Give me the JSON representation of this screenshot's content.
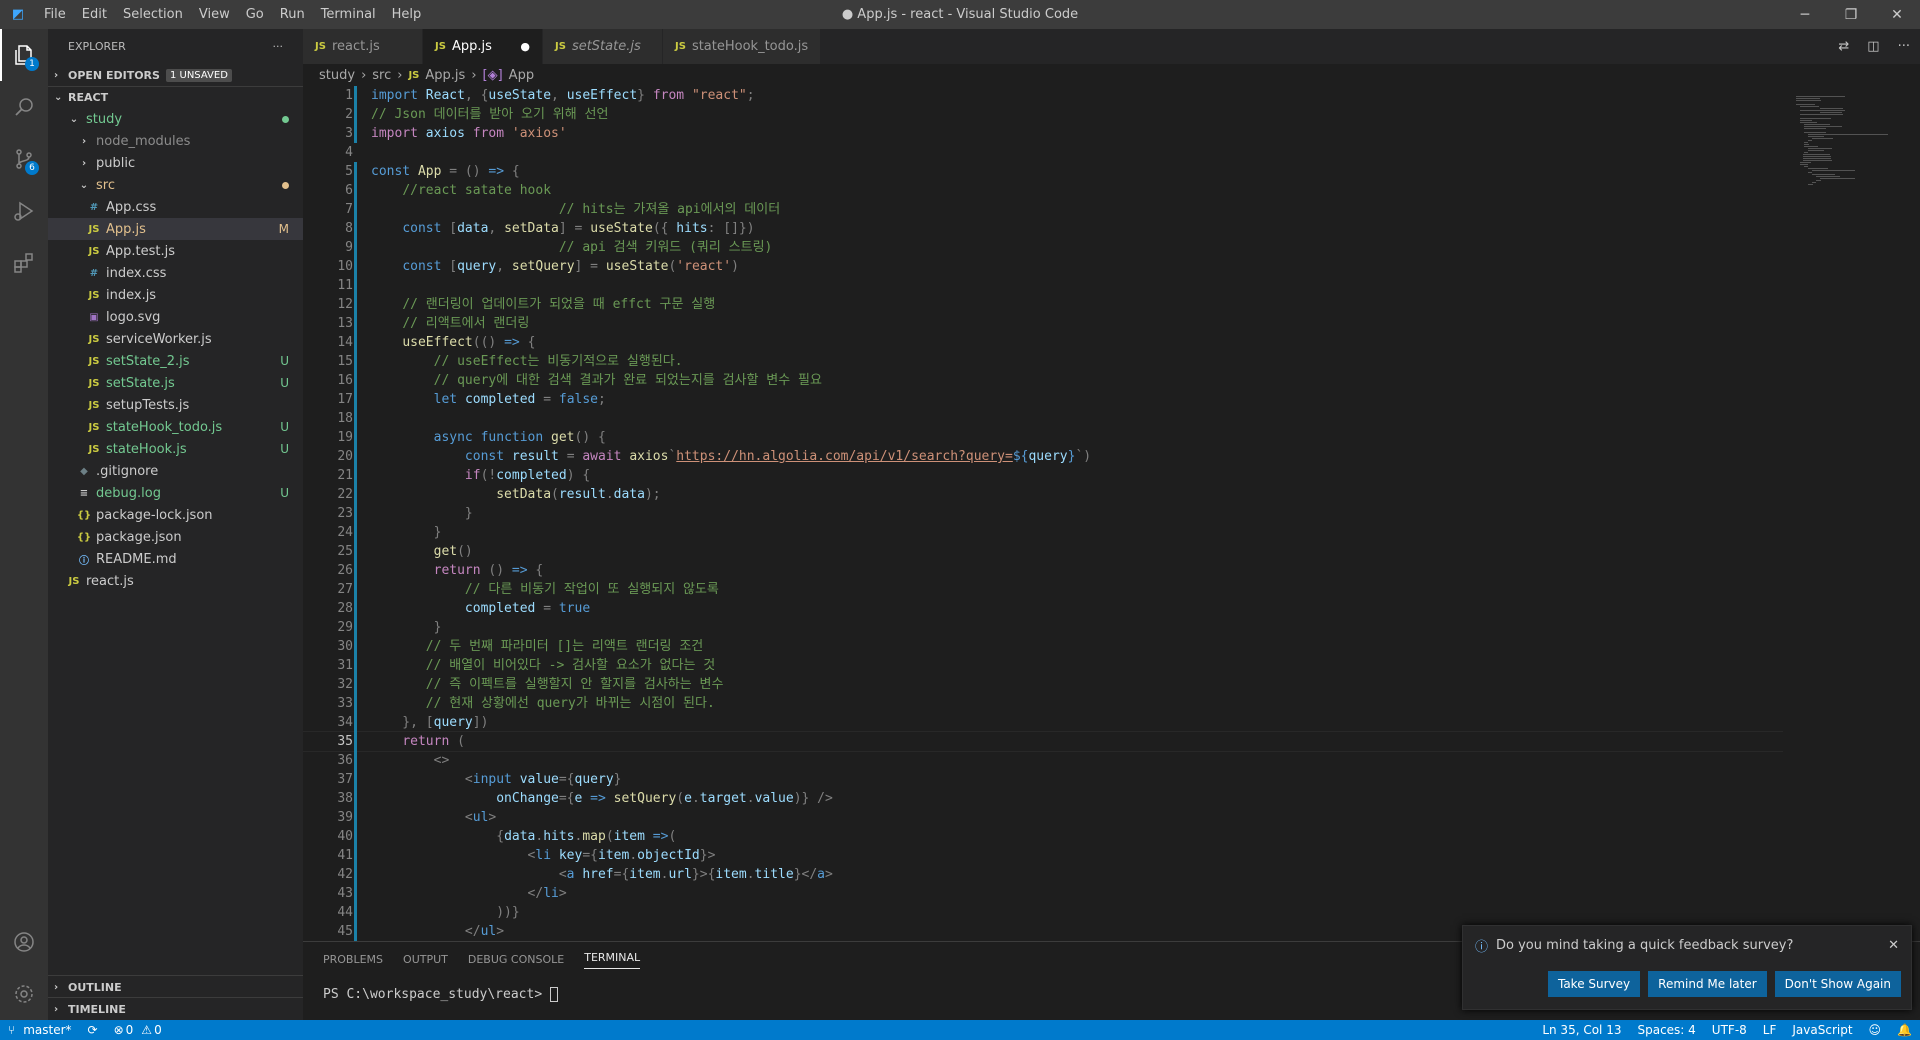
{
  "titlebar": {
    "menu": [
      "File",
      "Edit",
      "Selection",
      "View",
      "Go",
      "Run",
      "Terminal",
      "Help"
    ],
    "title": "● App.js - react - Visual Studio Code"
  },
  "activity": {
    "explorer_badge": "1",
    "scm_badge": "6"
  },
  "sidebar": {
    "header": "EXPLORER",
    "open_editors": "OPEN EDITORS",
    "unsaved": "1 UNSAVED",
    "root": "REACT",
    "items": [
      {
        "label": "study",
        "kind": "folder-open",
        "indent": 1,
        "status": "dot",
        "color": "green"
      },
      {
        "label": "node_modules",
        "kind": "folder",
        "indent": 2,
        "status": "",
        "color": "gray"
      },
      {
        "label": "public",
        "kind": "folder",
        "indent": 2,
        "status": "",
        "color": "normal"
      },
      {
        "label": "src",
        "kind": "folder-open",
        "indent": 2,
        "status": "dot",
        "color": "mod"
      },
      {
        "label": "App.css",
        "kind": "css",
        "indent": 3,
        "status": "",
        "color": "normal"
      },
      {
        "label": "App.js",
        "kind": "js",
        "indent": 3,
        "status": "M",
        "color": "mod",
        "selected": true
      },
      {
        "label": "App.test.js",
        "kind": "js",
        "indent": 3,
        "status": "",
        "color": "normal"
      },
      {
        "label": "index.css",
        "kind": "css",
        "indent": 3,
        "status": "",
        "color": "normal"
      },
      {
        "label": "index.js",
        "kind": "js",
        "indent": 3,
        "status": "",
        "color": "normal"
      },
      {
        "label": "logo.svg",
        "kind": "svg",
        "indent": 3,
        "status": "",
        "color": "normal"
      },
      {
        "label": "serviceWorker.js",
        "kind": "js",
        "indent": 3,
        "status": "",
        "color": "normal"
      },
      {
        "label": "setState_2.js",
        "kind": "js",
        "indent": 3,
        "status": "U",
        "color": "green"
      },
      {
        "label": "setState.js",
        "kind": "js",
        "indent": 3,
        "status": "U",
        "color": "green"
      },
      {
        "label": "setupTests.js",
        "kind": "js",
        "indent": 3,
        "status": "",
        "color": "normal"
      },
      {
        "label": "stateHook_todo.js",
        "kind": "js",
        "indent": 3,
        "status": "U",
        "color": "green"
      },
      {
        "label": "stateHook.js",
        "kind": "js",
        "indent": 3,
        "status": "U",
        "color": "green"
      },
      {
        "label": ".gitignore",
        "kind": "git",
        "indent": 2,
        "status": "",
        "color": "normal"
      },
      {
        "label": "debug.log",
        "kind": "log",
        "indent": 2,
        "status": "U",
        "color": "green"
      },
      {
        "label": "package-lock.json",
        "kind": "json",
        "indent": 2,
        "status": "",
        "color": "normal"
      },
      {
        "label": "package.json",
        "kind": "json",
        "indent": 2,
        "status": "",
        "color": "normal"
      },
      {
        "label": "README.md",
        "kind": "info",
        "indent": 2,
        "status": "",
        "color": "normal"
      },
      {
        "label": "react.js",
        "kind": "js",
        "indent": 1,
        "status": "",
        "color": "normal"
      }
    ],
    "outline": "OUTLINE",
    "timeline": "TIMELINE"
  },
  "tabs": [
    {
      "label": "react.js",
      "active": false,
      "italic": false
    },
    {
      "label": "App.js",
      "active": true,
      "italic": false,
      "dirty": "●"
    },
    {
      "label": "setState.js",
      "active": false,
      "italic": true
    },
    {
      "label": "stateHook_todo.js",
      "active": false,
      "italic": false
    }
  ],
  "breadcrumb": [
    "study",
    "src",
    "App.js",
    "App"
  ],
  "code": [
    [
      [
        "k",
        "import "
      ],
      [
        "v",
        "React"
      ],
      [
        "t",
        ", {"
      ],
      [
        "v",
        "useState"
      ],
      [
        "t",
        ", "
      ],
      [
        "v",
        "useEffect"
      ],
      [
        "t",
        "} "
      ],
      [
        "p",
        "from "
      ],
      [
        "s",
        "\"react\""
      ],
      [
        "t",
        ";"
      ]
    ],
    [
      [
        "c",
        "// Json 데이터를 받아 오기 위해 선언"
      ]
    ],
    [
      [
        "p",
        "import "
      ],
      [
        "v",
        "axios "
      ],
      [
        "p",
        "from "
      ],
      [
        "s",
        "'axios'"
      ]
    ],
    [],
    [
      [
        "k",
        "const "
      ],
      [
        "f",
        "App "
      ],
      [
        "t",
        "= () "
      ],
      [
        "k",
        "=> "
      ],
      [
        "t",
        "{"
      ]
    ],
    [
      [
        "t",
        "    "
      ],
      [
        "c",
        "//react satate hook"
      ]
    ],
    [
      [
        "t",
        "                        "
      ],
      [
        "c",
        "// hits는 가져올 api에서의 데이터"
      ]
    ],
    [
      [
        "t",
        "    "
      ],
      [
        "k",
        "const "
      ],
      [
        "t",
        "["
      ],
      [
        "v",
        "data"
      ],
      [
        "t",
        ", "
      ],
      [
        "f",
        "setData"
      ],
      [
        "t",
        "] = "
      ],
      [
        "f",
        "useState"
      ],
      [
        "t",
        "({ "
      ],
      [
        "v",
        "hits"
      ],
      [
        "t",
        ": []})"
      ]
    ],
    [
      [
        "t",
        "                        "
      ],
      [
        "c",
        "// api 검색 키워드 (쿼리 스트링)"
      ]
    ],
    [
      [
        "t",
        "    "
      ],
      [
        "k",
        "const "
      ],
      [
        "t",
        "["
      ],
      [
        "v",
        "query"
      ],
      [
        "t",
        ", "
      ],
      [
        "f",
        "setQuery"
      ],
      [
        "t",
        "] = "
      ],
      [
        "f",
        "useState"
      ],
      [
        "t",
        "("
      ],
      [
        "s",
        "'react'"
      ],
      [
        "t",
        ")"
      ]
    ],
    [],
    [
      [
        "t",
        "    "
      ],
      [
        "c",
        "// 랜더링이 업데이트가 되었을 때 effct 구문 실행"
      ]
    ],
    [
      [
        "t",
        "    "
      ],
      [
        "c",
        "// 리액트에서 랜더링"
      ]
    ],
    [
      [
        "t",
        "    "
      ],
      [
        "f",
        "useEffect"
      ],
      [
        "t",
        "(() "
      ],
      [
        "k",
        "=> "
      ],
      [
        "t",
        "{"
      ]
    ],
    [
      [
        "t",
        "        "
      ],
      [
        "c",
        "// useEffect는 비동기적으로 실행된다."
      ]
    ],
    [
      [
        "t",
        "        "
      ],
      [
        "c",
        "// query에 대한 검색 결과가 완료 되었는지를 검사할 변수 필요"
      ]
    ],
    [
      [
        "t",
        "        "
      ],
      [
        "k",
        "let "
      ],
      [
        "v",
        "completed "
      ],
      [
        "t",
        "= "
      ],
      [
        "k",
        "false"
      ],
      [
        "t",
        ";"
      ]
    ],
    [],
    [
      [
        "t",
        "        "
      ],
      [
        "k",
        "async function "
      ],
      [
        "f",
        "get"
      ],
      [
        "t",
        "() {"
      ]
    ],
    [
      [
        "t",
        "            "
      ],
      [
        "k",
        "const "
      ],
      [
        "v",
        "result "
      ],
      [
        "t",
        "= "
      ],
      [
        "p",
        "await "
      ],
      [
        "f",
        "axios"
      ],
      [
        "t",
        "`"
      ],
      [
        "u",
        "https://hn.algolia.com/api/v1/search?query="
      ],
      [
        "k",
        "${"
      ],
      [
        "v",
        "query"
      ],
      [
        "k",
        "}"
      ],
      [
        "t",
        "`)"
      ]
    ],
    [
      [
        "t",
        "            "
      ],
      [
        "p",
        "if"
      ],
      [
        "t",
        "(!"
      ],
      [
        "v",
        "completed"
      ],
      [
        "t",
        ") {"
      ]
    ],
    [
      [
        "t",
        "                "
      ],
      [
        "f",
        "setData"
      ],
      [
        "t",
        "("
      ],
      [
        "v",
        "result"
      ],
      [
        "t",
        "."
      ],
      [
        "v",
        "data"
      ],
      [
        "t",
        ");"
      ]
    ],
    [
      [
        "t",
        "            }"
      ]
    ],
    [
      [
        "t",
        "        }"
      ]
    ],
    [
      [
        "t",
        "        "
      ],
      [
        "f",
        "get"
      ],
      [
        "t",
        "()"
      ]
    ],
    [
      [
        "t",
        "        "
      ],
      [
        "p",
        "return "
      ],
      [
        "t",
        "() "
      ],
      [
        "k",
        "=> "
      ],
      [
        "t",
        "{"
      ]
    ],
    [
      [
        "t",
        "            "
      ],
      [
        "c",
        "// 다른 비동기 작업이 또 실행되지 않도록"
      ]
    ],
    [
      [
        "t",
        "            "
      ],
      [
        "v",
        "completed "
      ],
      [
        "t",
        "= "
      ],
      [
        "k",
        "true"
      ]
    ],
    [
      [
        "t",
        "        }"
      ]
    ],
    [
      [
        "t",
        "       "
      ],
      [
        "c",
        "// 두 번째 파라미터 []는 리액트 랜더링 조건"
      ]
    ],
    [
      [
        "t",
        "       "
      ],
      [
        "c",
        "// 배열이 비어있다 -> 검사할 요소가 없다는 것"
      ]
    ],
    [
      [
        "t",
        "       "
      ],
      [
        "c",
        "// 즉 이펙트를 실행할지 안 할지를 검사하는 변수"
      ]
    ],
    [
      [
        "t",
        "       "
      ],
      [
        "c",
        "// 현재 상황에선 query가 바뀌는 시점이 된다."
      ]
    ],
    [
      [
        "t",
        "    }, ["
      ],
      [
        "v",
        "query"
      ],
      [
        "t",
        "])"
      ]
    ],
    [
      [
        "t",
        "    "
      ],
      [
        "p",
        "return "
      ],
      [
        "t",
        "("
      ]
    ],
    [
      [
        "t",
        "        "
      ],
      [
        "t",
        "<>"
      ]
    ],
    [
      [
        "t",
        "            "
      ],
      [
        "t",
        "<"
      ],
      [
        "tg",
        "input "
      ],
      [
        "v",
        "value"
      ],
      [
        "t",
        "={"
      ],
      [
        "v",
        "query"
      ],
      [
        "t",
        "}"
      ]
    ],
    [
      [
        "t",
        "                "
      ],
      [
        "v",
        "onChange"
      ],
      [
        "t",
        "={"
      ],
      [
        "v",
        "e "
      ],
      [
        "k",
        "=> "
      ],
      [
        "f",
        "setQuery"
      ],
      [
        "t",
        "("
      ],
      [
        "v",
        "e"
      ],
      [
        "t",
        "."
      ],
      [
        "v",
        "target"
      ],
      [
        "t",
        "."
      ],
      [
        "v",
        "value"
      ],
      [
        "t",
        ")} />"
      ]
    ],
    [
      [
        "t",
        "            "
      ],
      [
        "t",
        "<"
      ],
      [
        "tg",
        "ul"
      ],
      [
        "t",
        ">"
      ]
    ],
    [
      [
        "t",
        "                {"
      ],
      [
        "v",
        "data"
      ],
      [
        "t",
        "."
      ],
      [
        "v",
        "hits"
      ],
      [
        "t",
        "."
      ],
      [
        "f",
        "map"
      ],
      [
        "t",
        "("
      ],
      [
        "v",
        "item "
      ],
      [
        "k",
        "=>"
      ],
      [
        "t",
        "("
      ]
    ],
    [
      [
        "t",
        "                    "
      ],
      [
        "t",
        "<"
      ],
      [
        "tg",
        "li "
      ],
      [
        "v",
        "key"
      ],
      [
        "t",
        "={"
      ],
      [
        "v",
        "item"
      ],
      [
        "t",
        "."
      ],
      [
        "v",
        "objectId"
      ],
      [
        "t",
        "}>"
      ]
    ],
    [
      [
        "t",
        "                        "
      ],
      [
        "t",
        "<"
      ],
      [
        "tg",
        "a "
      ],
      [
        "v",
        "href"
      ],
      [
        "t",
        "={"
      ],
      [
        "v",
        "item"
      ],
      [
        "t",
        "."
      ],
      [
        "v",
        "url"
      ],
      [
        "t",
        "}>{"
      ],
      [
        "v",
        "item"
      ],
      [
        "t",
        "."
      ],
      [
        "v",
        "title"
      ],
      [
        "t",
        "}</"
      ],
      [
        "tg",
        "a"
      ],
      [
        "t",
        ">"
      ]
    ],
    [
      [
        "t",
        "                    "
      ],
      [
        "t",
        "</"
      ],
      [
        "tg",
        "li"
      ],
      [
        "t",
        ">"
      ]
    ],
    [
      [
        "t",
        "                ))}"
      ]
    ],
    [
      [
        "t",
        "            "
      ],
      [
        "t",
        "</"
      ],
      [
        "tg",
        "ul"
      ],
      [
        "t",
        ">"
      ]
    ]
  ],
  "current_line": 35,
  "panel": {
    "tabs": [
      "PROBLEMS",
      "OUTPUT",
      "DEBUG CONSOLE",
      "TERMINAL"
    ],
    "active": "TERMINAL",
    "prompt": "PS C:\\workspace_study\\react> "
  },
  "notification": {
    "message": "Do you mind taking a quick feedback survey?",
    "buttons": [
      "Take Survey",
      "Remind Me later",
      "Don't Show Again"
    ]
  },
  "status": {
    "branch": "master*",
    "errors": "0",
    "warnings": "0",
    "position": "Ln 35, Col 13",
    "spaces": "Spaces: 4",
    "encoding": "UTF-8",
    "eol": "LF",
    "language": "JavaScript"
  },
  "colors": {
    "accent": "#007acc",
    "titlebar": "#3c3c3c",
    "activity": "#333333",
    "sidebar": "#252526",
    "editor": "#1e1e1e"
  }
}
